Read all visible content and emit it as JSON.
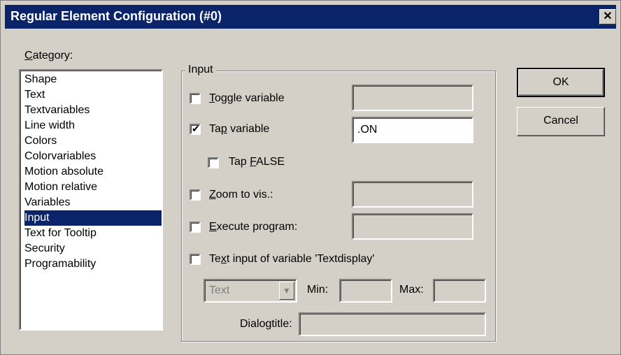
{
  "window": {
    "title": "Regular Element Configuration (#0)",
    "close_glyph": "✕"
  },
  "category": {
    "label_prefix": "C",
    "label_rest": "ategory:",
    "items": [
      {
        "label": "Shape"
      },
      {
        "label": "Text"
      },
      {
        "label": "Textvariables"
      },
      {
        "label": "Line width"
      },
      {
        "label": "Colors"
      },
      {
        "label": "Colorvariables"
      },
      {
        "label": "Motion absolute"
      },
      {
        "label": "Motion relative"
      },
      {
        "label": "Variables"
      },
      {
        "label": "Input",
        "selected": true
      },
      {
        "label": "Text for Tooltip"
      },
      {
        "label": "Security"
      },
      {
        "label": "Programability"
      }
    ]
  },
  "input_group": {
    "title": "Input",
    "toggle_variable": {
      "pre": "",
      "mn": "T",
      "post": "oggle variable",
      "checked": false,
      "value": ""
    },
    "tap_variable": {
      "pre": "Ta",
      "mn": "p",
      "post": " variable",
      "checked": true,
      "value": ".ON"
    },
    "tap_false": {
      "pre": "Tap ",
      "mn": "F",
      "post": "ALSE",
      "checked": false
    },
    "zoom_to_vis": {
      "pre": "",
      "mn": "Z",
      "post": "oom to vis.:",
      "checked": false,
      "value": ""
    },
    "execute_program": {
      "pre": "",
      "mn": "E",
      "post": "xecute program:",
      "checked": false,
      "value": ""
    },
    "text_input": {
      "pre": "Te",
      "mn": "x",
      "post": "t input of variable 'Textdisplay'",
      "checked": false
    },
    "type_select": {
      "value": "Text",
      "arrow": "▼"
    },
    "min_label": "Min:",
    "max_label": "Max:",
    "min_value": "",
    "max_value": "",
    "dialogtitle_label": "Dialogtitle:",
    "dialogtitle_value": ""
  },
  "buttons": {
    "ok": "OK",
    "cancel": "Cancel"
  },
  "colors": {
    "titlebar": "#0a246a",
    "face": "#d4d0c8",
    "selection": "#0a246a"
  }
}
